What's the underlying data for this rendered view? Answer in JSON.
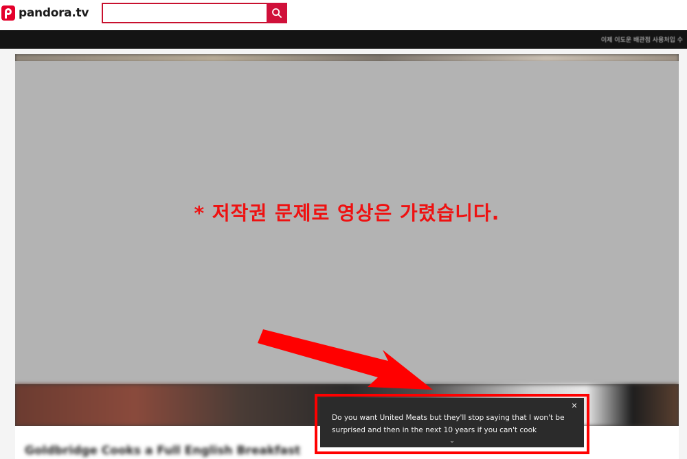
{
  "header": {
    "logo_text": "pandora.tv",
    "search_value": "",
    "search_placeholder": ""
  },
  "topbar": {
    "marquee_text": "이제 이도운 배관점 사용처입 수"
  },
  "video": {
    "notice_text": "* 저작권 문제로 영상은 가렸습니다.",
    "title": "Goldbridge Cooks a Full English Breakfast"
  },
  "caption": {
    "text": "Do you want United Meats but they'll stop saying that I won't be surprised and then in the next 10 years if you can't cook",
    "close_glyph": "✕",
    "expand_glyph": "⌄"
  },
  "colors": {
    "brand": "#e4002b",
    "notice": "#ee1111",
    "outline": "#ff0000",
    "caption_bg": "#2b2b2b"
  },
  "icons": [
    "pandora-logo-icon",
    "search-icon",
    "close-icon",
    "chevron-down-icon",
    "arrow-annotation"
  ]
}
